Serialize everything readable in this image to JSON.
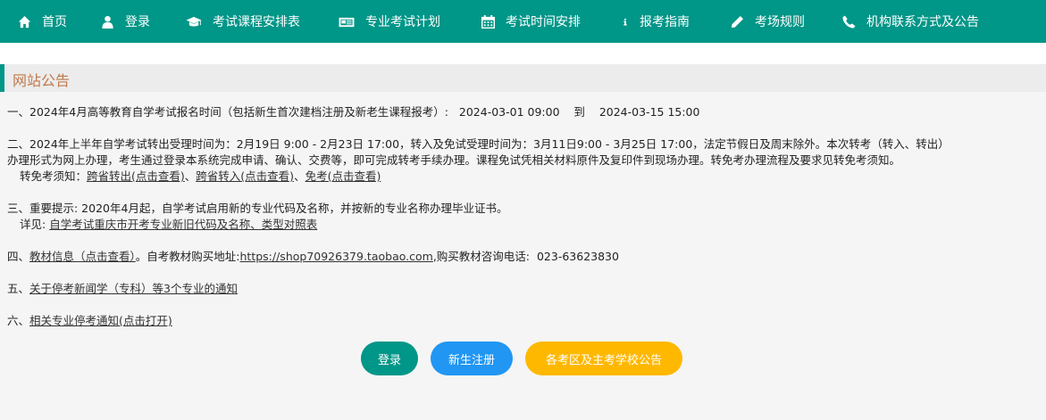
{
  "nav": {
    "items": [
      {
        "label": "首页",
        "icon": "home-icon"
      },
      {
        "label": "登录",
        "icon": "user-icon"
      },
      {
        "label": "考试课程安排表",
        "icon": "graduation-cap-icon"
      },
      {
        "label": "专业考试计划",
        "icon": "newspaper-icon"
      },
      {
        "label": "考试时间安排",
        "icon": "calendar-icon"
      },
      {
        "label": "报考指南",
        "icon": "info-icon"
      },
      {
        "label": "考场规则",
        "icon": "pencil-icon"
      },
      {
        "label": "机构联系方式及公告",
        "icon": "phone-icon"
      }
    ]
  },
  "section": {
    "title": "网站公告"
  },
  "notices": {
    "n1": {
      "text": "一、2024年4月高等教育自学考试报名时间（包括新生首次建档注册及新老生课程报考）:   2024-03-01 09:00    到    2024-03-15 15:00"
    },
    "n2": {
      "line1": "二、2024年上半年自学考试转出受理时间为：2月19日 9:00 - 2月23日 17:00，转入及免试受理时间为：3月11日9:00 - 3月25日 17:00，法定节假日及周末除外。本次转考（转入、转出）",
      "line2": "办理形式为网上办理，考生通过登录本系统完成申请、确认、交费等，即可完成转考手续办理。课程免试凭相关材料原件及复印件到现场办理。转免考办理流程及要求见转免考须知。",
      "prefix": "转免考须知：",
      "link1": "跨省转出(点击查看)",
      "sep1": "、",
      "link2": "跨省转入(点击查看)",
      "sep2": "、",
      "link3": "免考(点击查看)"
    },
    "n3": {
      "line1": "三、重要提示: 2020年4月起，自学考试启用新的专业代码及名称，并按新的专业名称办理毕业证书。",
      "prefix": "详见: ",
      "link": "自学考试重庆市开考专业新旧代码及名称、类型对照表"
    },
    "n4": {
      "prefix": "四、",
      "link1": "教材信息（点击查看）",
      "mid": "。自考教材购买地址:",
      "link2": "https://shop70926379.taobao.com",
      "suffix": ",购买教材咨询电话:  023-63623830"
    },
    "n5": {
      "prefix": "五、",
      "link": "关于停考新闻学（专科）等3个专业的通知"
    },
    "n6": {
      "prefix": "六、",
      "link": "相关专业停考通知(点击打开)"
    }
  },
  "buttons": {
    "login": "登录",
    "register": "新生注册",
    "notice": "各考区及主考学校公告"
  },
  "colors": {
    "nav": "#009688",
    "register": "#2196f3",
    "notice": "#ffb800",
    "title": "#c0784c"
  }
}
